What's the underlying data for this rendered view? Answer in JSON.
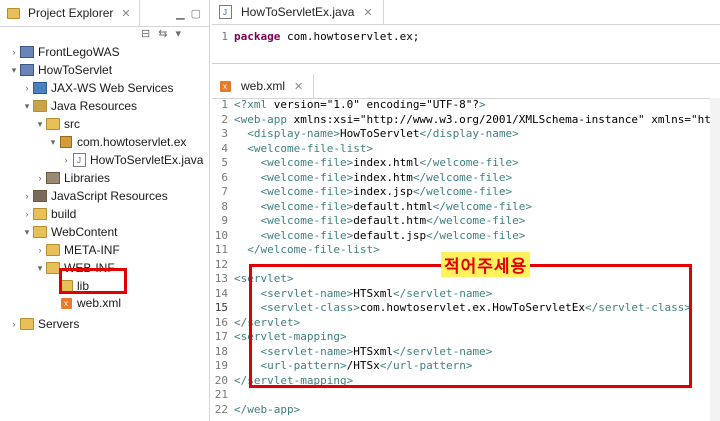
{
  "explorer": {
    "tab_title": "Project Explorer",
    "tree": [
      {
        "label": "FrontLegoWAS",
        "level": 0,
        "expanded": false,
        "icon": "project-icon"
      },
      {
        "label": "HowToServlet",
        "level": 0,
        "expanded": true,
        "icon": "project-icon"
      },
      {
        "label": "JAX-WS Web Services",
        "level": 1,
        "expanded": false,
        "icon": "web-services-icon"
      },
      {
        "label": "Java Resources",
        "level": 1,
        "expanded": true,
        "icon": "java-resources-icon"
      },
      {
        "label": "src",
        "level": 2,
        "expanded": true,
        "icon": "source-folder-icon"
      },
      {
        "label": "com.howtoservlet.ex",
        "level": 3,
        "expanded": true,
        "icon": "package-icon"
      },
      {
        "label": "HowToServletEx.java",
        "level": 4,
        "expanded": false,
        "icon": "java-file-icon"
      },
      {
        "label": "Libraries",
        "level": 2,
        "expanded": false,
        "icon": "libraries-icon"
      },
      {
        "label": "JavaScript Resources",
        "level": 1,
        "expanded": false,
        "icon": "javascript-resources-icon"
      },
      {
        "label": "build",
        "level": 1,
        "expanded": false,
        "icon": "folder-icon"
      },
      {
        "label": "WebContent",
        "level": 1,
        "expanded": true,
        "icon": "folder-icon"
      },
      {
        "label": "META-INF",
        "level": 2,
        "expanded": false,
        "icon": "folder-icon"
      },
      {
        "label": "WEB-INF",
        "level": 2,
        "expanded": true,
        "icon": "folder-icon"
      },
      {
        "label": "lib",
        "level": 3,
        "expanded": false,
        "icon": "folder-icon"
      },
      {
        "label": "web.xml",
        "level": 3,
        "expanded": false,
        "icon": "xml-file-icon"
      },
      {
        "label": "Servers",
        "level": 0,
        "expanded": false,
        "icon": "folder-icon"
      }
    ]
  },
  "editor_top": {
    "tab_title": "HowToServletEx.java",
    "lines": [
      {
        "num": "1",
        "keyword": "package",
        "rest": " com.howtoservlet.ex;"
      }
    ]
  },
  "editor_main": {
    "tab_title": "web.xml",
    "annotation": "적어주세용",
    "lines": [
      {
        "num": "1",
        "text": "<?xml version=\"1.0\" encoding=\"UTF-8\"?>"
      },
      {
        "num": "2",
        "text": "<web-app xmlns:xsi=\"http://www.w3.org/2001/XMLSchema-instance\" xmlns=\"http"
      },
      {
        "num": "3",
        "text": "  <display-name>HowToServlet</display-name>"
      },
      {
        "num": "4",
        "text": "  <welcome-file-list>"
      },
      {
        "num": "5",
        "text": "    <welcome-file>index.html</welcome-file>"
      },
      {
        "num": "6",
        "text": "    <welcome-file>index.htm</welcome-file>"
      },
      {
        "num": "7",
        "text": "    <welcome-file>index.jsp</welcome-file>"
      },
      {
        "num": "8",
        "text": "    <welcome-file>default.html</welcome-file>"
      },
      {
        "num": "9",
        "text": "    <welcome-file>default.htm</welcome-file>"
      },
      {
        "num": "10",
        "text": "    <welcome-file>default.jsp</welcome-file>"
      },
      {
        "num": "11",
        "text": "  </welcome-file-list>"
      },
      {
        "num": "12",
        "text": ""
      },
      {
        "num": "13",
        "text": "<servlet>"
      },
      {
        "num": "14",
        "text": "    <servlet-name>HTSxml</servlet-name>"
      },
      {
        "num": "15",
        "text": "    <servlet-class>com.howtoservlet.ex.HowToServletEx</servlet-class>"
      },
      {
        "num": "16",
        "text": "</servlet>"
      },
      {
        "num": "17",
        "text": "<servlet-mapping>"
      },
      {
        "num": "18",
        "text": "    <servlet-name>HTSxml</servlet-name>"
      },
      {
        "num": "19",
        "text": "    <url-pattern>/HTSx</url-pattern>"
      },
      {
        "num": "20",
        "text": "</servlet-mapping>"
      },
      {
        "num": "21",
        "text": ""
      },
      {
        "num": "22",
        "text": "</web-app>"
      }
    ]
  }
}
